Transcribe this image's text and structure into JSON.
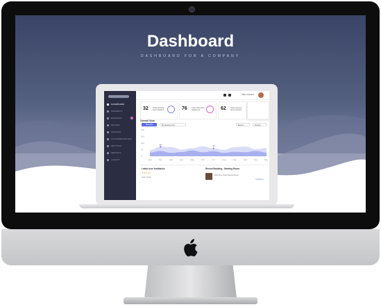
{
  "hero": {
    "title": "Dashboard",
    "subtitle": "DASHBOARD FOR A COMPANY"
  },
  "sidebar": {
    "items": [
      {
        "label": "DASHBOARD",
        "active": true
      },
      {
        "label": "PROPERTY"
      },
      {
        "label": "BOOKINGS"
      },
      {
        "label": "MASTER"
      },
      {
        "label": "INVOICES"
      },
      {
        "label": "CUSTOMER REVIEW"
      },
      {
        "label": "SETTINGS"
      },
      {
        "label": "REPORTS"
      },
      {
        "label": "LOGOUT"
      }
    ]
  },
  "topbar": {
    "user_name": "Mike Howard"
  },
  "stats": [
    {
      "value": "32",
      "label": "Today Meeting Room Booked"
    },
    {
      "value": "76",
      "label": "Today Attendees Registered"
    },
    {
      "value": "62",
      "label": "Today Meeting Room Booked"
    }
  ],
  "overall": {
    "title": "Overall View",
    "primary_button": "Bookings",
    "select_value": "By Meeting room",
    "compare_button": "Metrics",
    "period_select": "Monthly"
  },
  "chart_data": {
    "type": "area",
    "categories": [
      "Jan",
      "Feb",
      "Mar",
      "Apr",
      "May",
      "Jun",
      "Jul",
      "Aug",
      "Sep",
      "Oct",
      "Nov",
      "Dec"
    ],
    "series": [
      {
        "values": [
          48,
          72,
          70,
          52,
          62,
          75,
          60,
          50,
          70,
          74,
          54,
          62
        ]
      },
      {
        "values": [
          28,
          40,
          26,
          32,
          44,
          30,
          38,
          26,
          34,
          30,
          40,
          28
        ]
      }
    ],
    "y_ticks": [
      "200",
      "150",
      "100",
      "50",
      "0"
    ],
    "ylim": [
      0,
      200
    ],
    "data_labels": [
      {
        "index": 1,
        "text": "90"
      },
      {
        "index": 6,
        "text": "75"
      }
    ]
  },
  "feedback": {
    "title": "Latest user feedbacks",
    "stars": "★★★★★",
    "reviewer": "Jason Smith"
  },
  "booking": {
    "title": "Recent Booking - Meeting Room",
    "room": "Park Zone Hotel Meeting Room",
    "status": "Confirmed"
  },
  "colors": {
    "accent": "#5c6ae0",
    "sidebar": "#2b2e43",
    "wave_light": "#d9dcf7",
    "wave_mid": "#a8afef",
    "badge": "#d865c9"
  }
}
